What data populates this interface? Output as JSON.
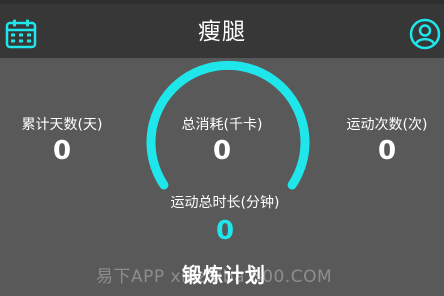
{
  "header": {
    "title": "瘦腿",
    "left_icon": "calendar-icon",
    "right_icon": "profile-icon"
  },
  "stats": {
    "days": {
      "label": "累计天数(天)",
      "value": "0"
    },
    "calories": {
      "label": "总消耗(千卡)",
      "value": "0"
    },
    "count": {
      "label": "运动次数(次)",
      "value": "0"
    },
    "duration": {
      "label": "运动总时长(分钟)",
      "value": "0"
    }
  },
  "gauge": {
    "level": 0
  },
  "plan_button": {
    "label": "锻炼计划"
  },
  "watermark": {
    "text": "易下APP xiazaiba 800.COM"
  },
  "colors": {
    "accent": "#1ee6ea",
    "header_bg": "#373737",
    "body_bg": "#595959",
    "text": "#ffffff"
  }
}
